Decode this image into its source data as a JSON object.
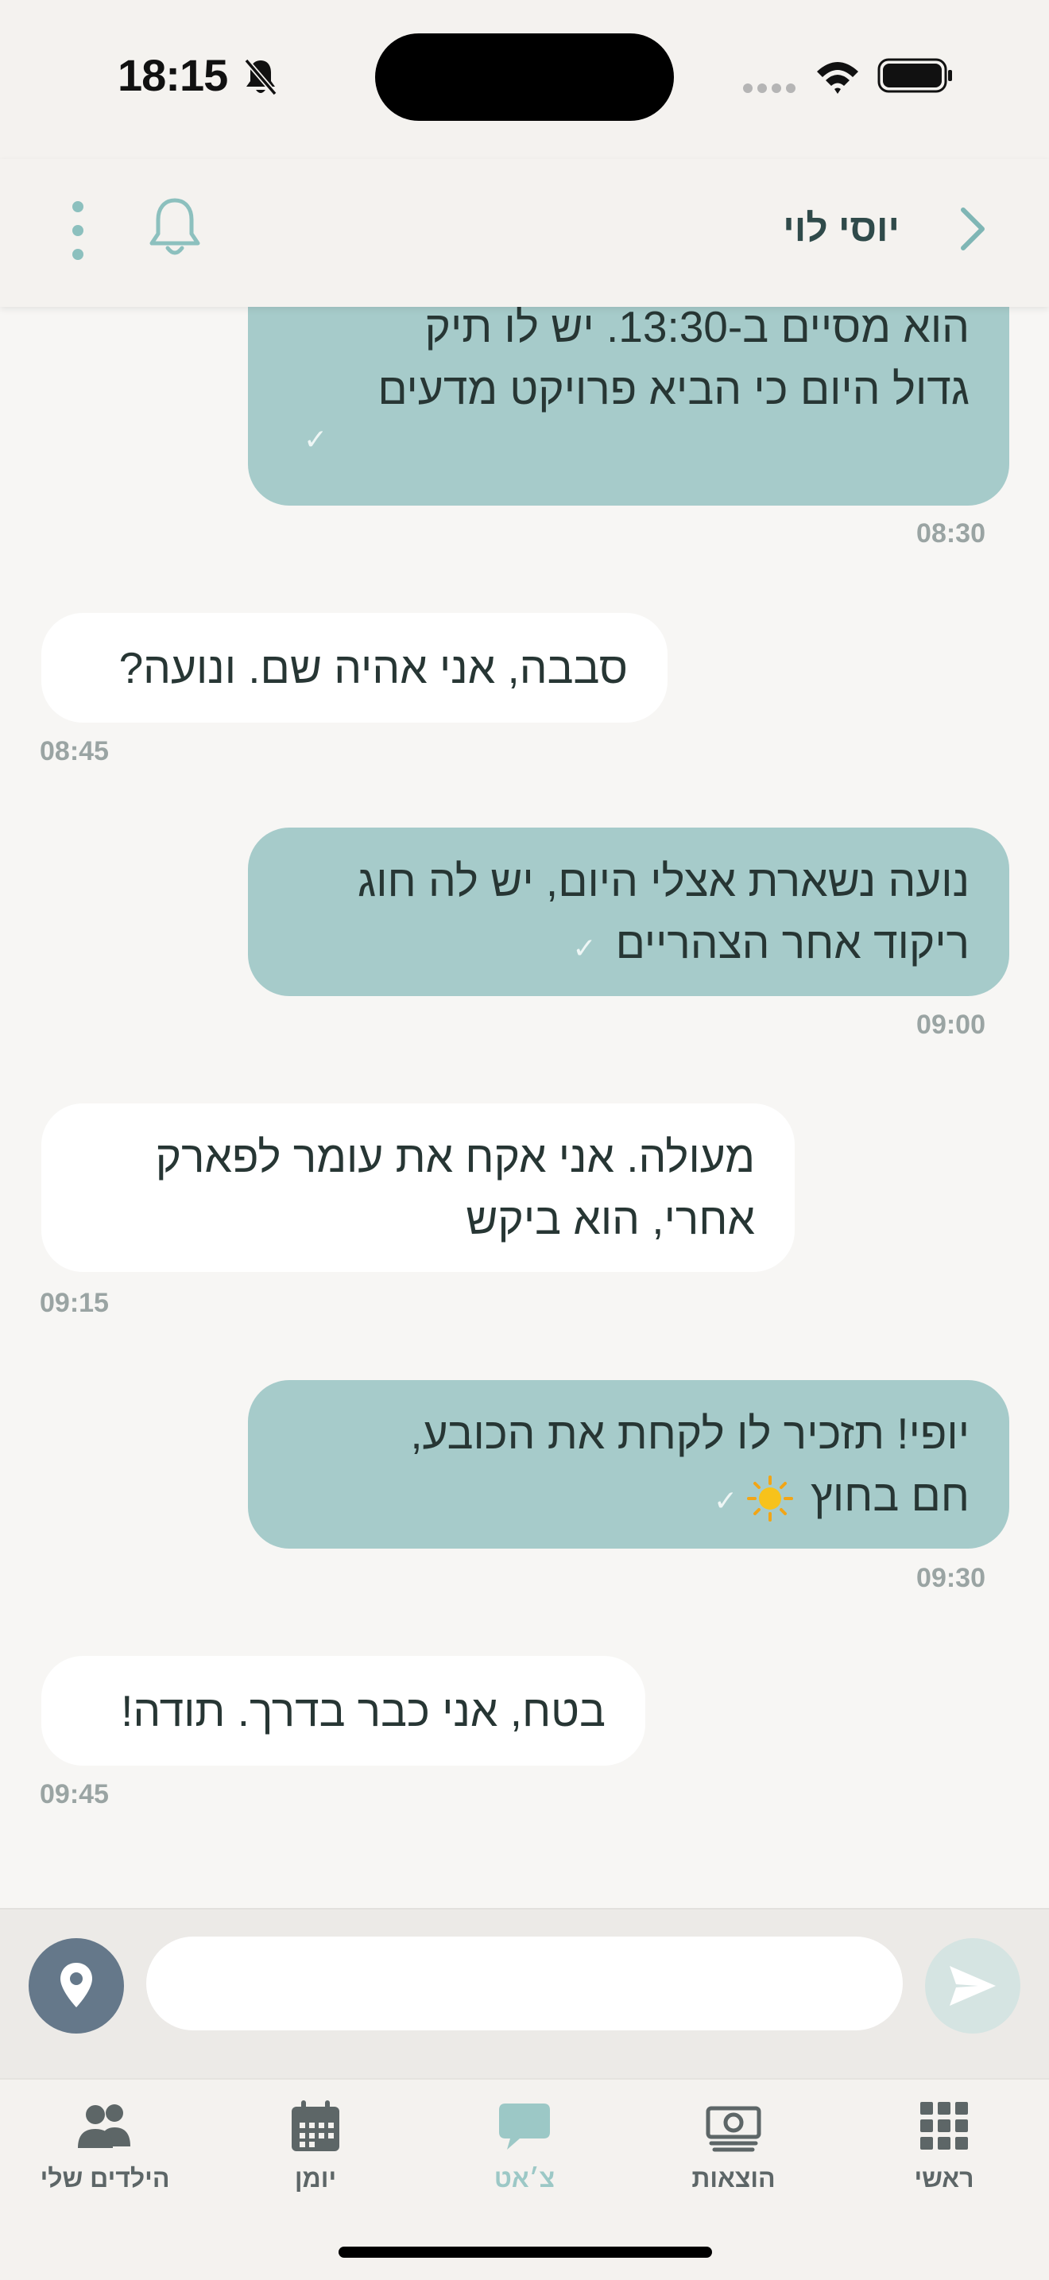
{
  "status_bar": {
    "time": "18:15"
  },
  "header": {
    "contact_name": "יוסי לוי"
  },
  "messages": [
    {
      "direction": "out",
      "lines": [
        "הוא מסיים ב-13:30. יש לו תיק",
        "גדול היום כי הביא פרויקט מדעים"
      ],
      "time": "08:30",
      "check": "✓"
    },
    {
      "direction": "in",
      "lines": [
        "סבבה, אני אהיה שם. ונועה?"
      ],
      "time": "08:45"
    },
    {
      "direction": "out",
      "lines": [
        "נועה נשארת אצלי היום, יש לה חוג",
        "ריקוד אחר הצהריים"
      ],
      "time": "09:00",
      "check": "✓"
    },
    {
      "direction": "in",
      "lines": [
        "מעולה. אני אקח את עומר לפארק",
        "אחרי, הוא ביקש"
      ],
      "time": "09:15"
    },
    {
      "direction": "out",
      "lines": [
        "יופי! תזכיר לו לקחת את הכובע,",
        "חם בחוץ"
      ],
      "time": "09:30",
      "check": "✓"
    },
    {
      "direction": "in",
      "lines": [
        "בטח, אני כבר בדרך. תודה!"
      ],
      "time": "09:45"
    }
  ],
  "input": {
    "placeholder": "",
    "value": ""
  },
  "tabs": [
    {
      "label": "ראשי",
      "icon": "grid-icon"
    },
    {
      "label": "הוצאות",
      "icon": "money-icon"
    },
    {
      "label": "צ׳אט",
      "icon": "chat-icon",
      "active": true
    },
    {
      "label": "יומן",
      "icon": "calendar-icon"
    },
    {
      "label": "הילדים שלי",
      "icon": "people-icon"
    }
  ],
  "colors": {
    "outgoing_bubble": "#a6cbca",
    "incoming_bubble": "#ffffff",
    "accent": "#9cc8c6",
    "location_button": "#65788a"
  }
}
